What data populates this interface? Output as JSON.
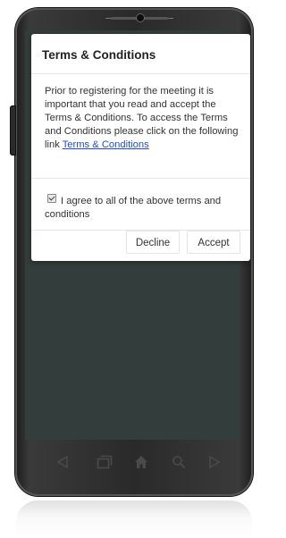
{
  "dialog": {
    "title": "Terms & Conditions",
    "body_text": "Prior to registering for the meeting it is important that you read and accept the Terms & Conditions. To access the Terms and Conditions please click on the following link ",
    "link_text": "Terms & Conditions",
    "agree_label": "I agree to all of the above terms and conditions",
    "agree_checked": true,
    "decline_label": "Decline",
    "accept_label": "Accept"
  },
  "navbar": {
    "icons": [
      "back-icon",
      "recent-apps-icon",
      "home-icon",
      "search-icon",
      "menu-icon"
    ]
  },
  "colors": {
    "screen_background": "#333d3b",
    "link": "#1f4bd6"
  }
}
